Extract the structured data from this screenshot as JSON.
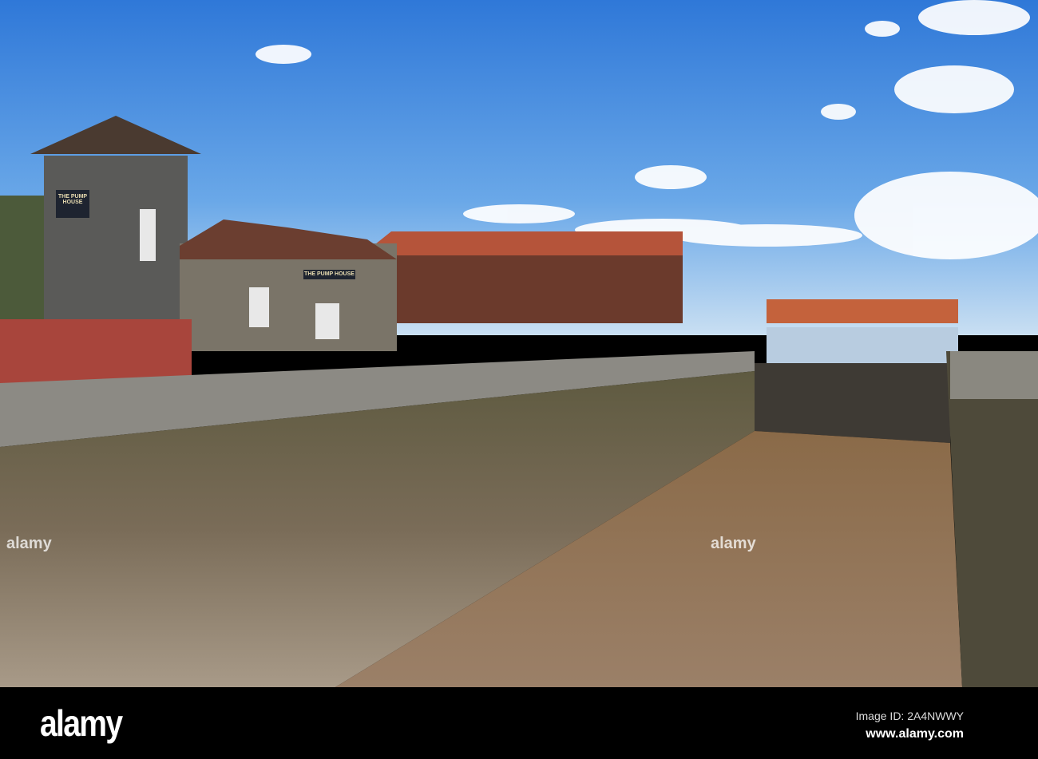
{
  "photo": {
    "signs": {
      "tower": "THE PUMP HOUSE",
      "building": "THE PUMP HOUSE"
    },
    "watermark": "alamy"
  },
  "footer": {
    "logo": "alamy",
    "image_id": "Image ID: 2A4NWWY",
    "url": "www.alamy.com"
  }
}
